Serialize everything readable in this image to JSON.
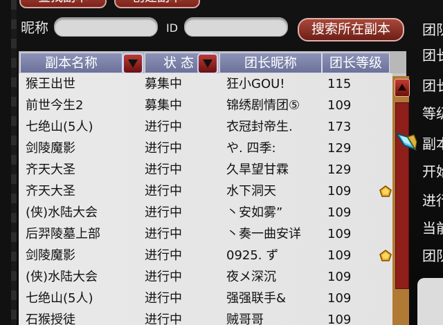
{
  "top_buttons": [
    "查找副本",
    "创建副本"
  ],
  "search": {
    "nickname_label": "昵称",
    "nickname_value": "",
    "id_label": "ID",
    "id_value": "",
    "button_label": "搜索所在副本"
  },
  "table": {
    "headers": {
      "name": "副本名称",
      "state": "状 态",
      "leader": "团长昵称",
      "level": "团长等级"
    },
    "rows": [
      {
        "name": "猴王出世",
        "state": "募集中",
        "leader": "狂小GOU!",
        "level": "115",
        "star": false
      },
      {
        "name": "前世今生2",
        "state": "募集中",
        "leader": "锦绣剧情团⑤",
        "level": "109",
        "star": false
      },
      {
        "name": "七绝山(5人)",
        "state": "进行中",
        "leader": "衣冠封帝生.",
        "level": "173",
        "star": false
      },
      {
        "name": "剑陵魔影",
        "state": "进行中",
        "leader": "や. 四季:",
        "level": "129",
        "star": false
      },
      {
        "name": "齐天大圣",
        "state": "进行中",
        "leader": "久旱望甘霖",
        "level": "129",
        "star": false
      },
      {
        "name": "齐天大圣",
        "state": "进行中",
        "leader": "水下洞天",
        "level": "109",
        "star": true
      },
      {
        "name": "(侠)水陆大会",
        "state": "进行中",
        "leader": "丶安如雾”",
        "level": "109",
        "star": false
      },
      {
        "name": "后羿陵墓上部",
        "state": "进行中",
        "leader": "丶奏一曲安详",
        "level": "109",
        "star": false
      },
      {
        "name": "剑陵魔影",
        "state": "进行中",
        "leader": "0925. ず",
        "level": "109",
        "star": true
      },
      {
        "name": "(侠)水陆大会",
        "state": "进行中",
        "leader": "夜メ深沉",
        "level": "109",
        "star": false
      },
      {
        "name": "七绝山(5人)",
        "state": "进行中",
        "leader": "强强联手&",
        "level": "109",
        "star": false
      },
      {
        "name": "石猴授徒",
        "state": "进行中",
        "leader": "贼哥哥",
        "level": "109",
        "star": false
      }
    ]
  },
  "right_panel": {
    "items": [
      "团队",
      "团长",
      "团长",
      "等级",
      "副本",
      "开始",
      "进行",
      "当前",
      "团队"
    ]
  },
  "colors": {
    "header_bg": "#7b81a9",
    "button_red": "#8f2d24",
    "row_bg": "#e6e6e6",
    "scroll_thumb": "#8e1f1b",
    "star_gold": "#f0b21a"
  }
}
